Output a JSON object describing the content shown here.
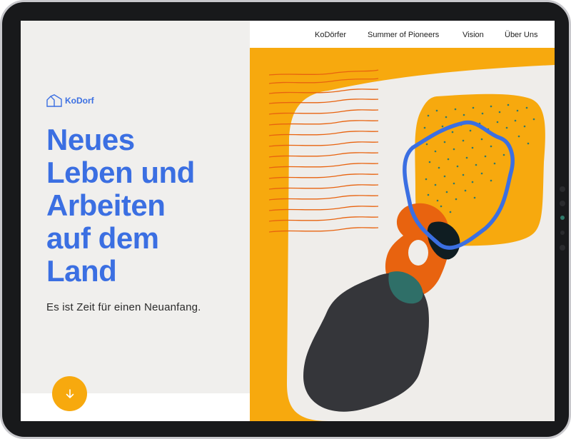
{
  "brand": {
    "name": "KoDorf"
  },
  "nav": {
    "items": [
      {
        "label": "KoDörfer"
      },
      {
        "label": "Summer of Pioneers"
      },
      {
        "label": "Vision"
      },
      {
        "label": "Über Uns"
      }
    ]
  },
  "hero": {
    "headline": "Neues\nLeben und\nArbeiten\nauf dem\nLand",
    "subtitle": "Es ist Zeit für einen Neuanfang."
  },
  "icons": {
    "logo": "house-outline-icon",
    "scroll": "arrow-down-icon"
  },
  "colors": {
    "accent_blue": "#3b6fe2",
    "accent_yellow": "#f7a90e",
    "background": "#f0efed",
    "orange": "#e8630f",
    "dark": "#35363a",
    "teal": "#2f7a6b"
  }
}
